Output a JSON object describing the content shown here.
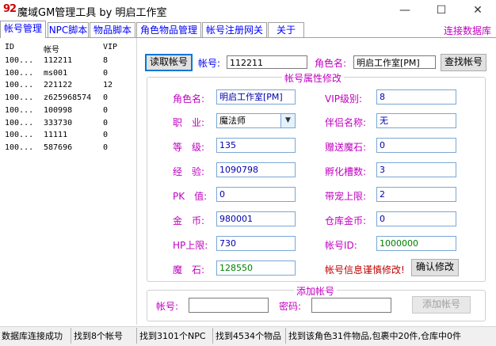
{
  "window": {
    "icon_text": "92",
    "title": "魔域GM管理工具 by 明启工作室",
    "minimize": "—",
    "maximize": "☐",
    "close": "✕"
  },
  "tabs": [
    {
      "label": "帐号管理",
      "active": true
    },
    {
      "label": "NPC脚本"
    },
    {
      "label": "物品脚本"
    },
    {
      "label": "角色物品管理"
    },
    {
      "label": "帐号注册网关"
    },
    {
      "label": "关于"
    }
  ],
  "connect_db": "连接数据库",
  "list": {
    "headers": [
      "ID",
      "帐号",
      "VIP"
    ],
    "rows": [
      [
        "100...",
        "112211",
        "8"
      ],
      [
        "100...",
        "ms001",
        "0"
      ],
      [
        "100...",
        "221122",
        "12"
      ],
      [
        "100...",
        "z625968574",
        "0"
      ],
      [
        "100...",
        "100998",
        "0"
      ],
      [
        "100...",
        "333730",
        "0"
      ],
      [
        "100...",
        "11111",
        "0"
      ],
      [
        "100...",
        "587696",
        "0"
      ]
    ]
  },
  "top": {
    "read_button": "读取帐号",
    "account_label": "帐号:",
    "account_value": "112211",
    "role_label": "角色名:",
    "role_value": "明启工作室[PM]",
    "find_button": "查找帐号"
  },
  "props": {
    "group_title": "帐号属性修改",
    "role_name_label": "角色名:",
    "role_name_value": "明启工作室[PM]",
    "vip_label": "VIP级别:",
    "vip_value": "8",
    "job_label": "职　业:",
    "job_value": "魔法师",
    "mate_label": "伴侣名称:",
    "mate_value": "无",
    "level_label": "等　级:",
    "level_value": "135",
    "gift_stone_label": "赠送魔石:",
    "gift_stone_value": "0",
    "exp_label": "经　验:",
    "exp_value": "1090798",
    "hatch_label": "孵化槽数:",
    "hatch_value": "3",
    "pk_label": "PK　值:",
    "pk_value": "0",
    "pet_limit_label": "带宠上限:",
    "pet_limit_value": "2",
    "gold_label": "金　币:",
    "gold_value": "980001",
    "warehouse_gold_label": "仓库金币:",
    "warehouse_gold_value": "0",
    "hp_label": "HP上限:",
    "hp_value": "730",
    "account_id_label": "帐号ID:",
    "account_id_value": "1000000",
    "magic_stone_label": "魔　石:",
    "magic_stone_value": "128550",
    "warning": "帐号信息谨慎修改!",
    "confirm_button": "确认修改"
  },
  "add": {
    "group_title": "添加帐号",
    "account_label": "帐号:",
    "password_label": "密码:",
    "add_button": "添加帐号"
  },
  "status": [
    "数据库连接成功",
    "找到8个帐号",
    "找到3101个NPC",
    "找到4534个物品",
    "找到该角色31件物品,包裹中20件,仓库中0件"
  ],
  "colors": {
    "accent_blue": "#0000ff",
    "accent_magenta": "#c000c0",
    "accent_green": "#008000"
  }
}
